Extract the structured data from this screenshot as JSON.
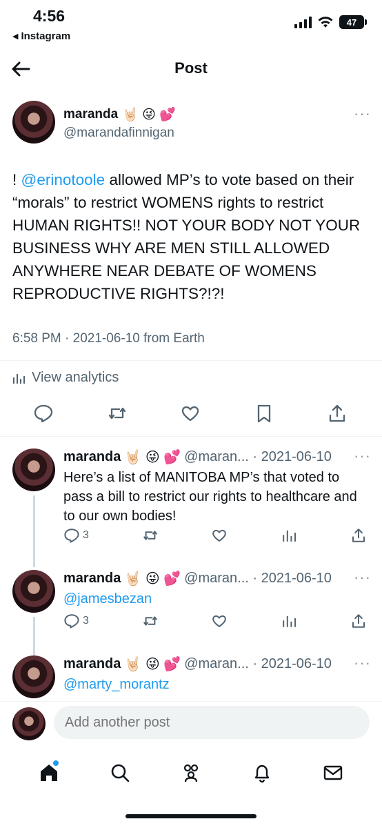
{
  "status_bar": {
    "time": "4:56",
    "back_app": "Instagram",
    "battery": "47"
  },
  "header": {
    "title": "Post"
  },
  "main_post": {
    "name": "maranda",
    "name_emojis": "🤘🏻 😜 💕",
    "handle": "@marandafinnigan",
    "text_prefix": "! ",
    "mention": "@erinotoole",
    "text_rest": " allowed MP’s to vote based on their “morals” to restrict WOMENS rights to restrict HUMAN RIGHTS!! NOT YOUR BODY NOT YOUR BUSINESS WHY ARE MEN STILL ALLOWED ANYWHERE NEAR DEBATE OF WOMENS REPRODUCTIVE RIGHTS?!?!",
    "meta": "6:58 PM · 2021-06-10 from Earth",
    "analytics_label": "View analytics",
    "more": "···"
  },
  "replies": [
    {
      "name": "maranda",
      "emojis": "🤘🏻 😜 💕",
      "handle_date": "@maran... · 2021-06-10",
      "text": "Here’s a list of MANITOBA MP’s that voted to pass a bill to restrict our rights to healthcare and to our own bodies!",
      "reply_count": "3",
      "more": "···"
    },
    {
      "name": "maranda",
      "emojis": "🤘🏻 😜 💕",
      "handle_date": "@maran... · 2021-06-10",
      "text": "@jamesbezan",
      "reply_count": "3",
      "more": "···"
    },
    {
      "name": "maranda",
      "emojis": "🤘🏻 😜 💕",
      "handle_date": "@maran... · 2021-06-10",
      "text": "@marty_morantz",
      "more": "···"
    }
  ],
  "compose": {
    "placeholder": "Add another post"
  },
  "tabbar": {
    "items": [
      "home-icon",
      "search-icon",
      "communities-icon",
      "notifications-icon",
      "messages-icon"
    ]
  },
  "colors": {
    "accent": "#1d9bf0",
    "secondary_text": "#536471",
    "divider": "#eff3f4"
  }
}
